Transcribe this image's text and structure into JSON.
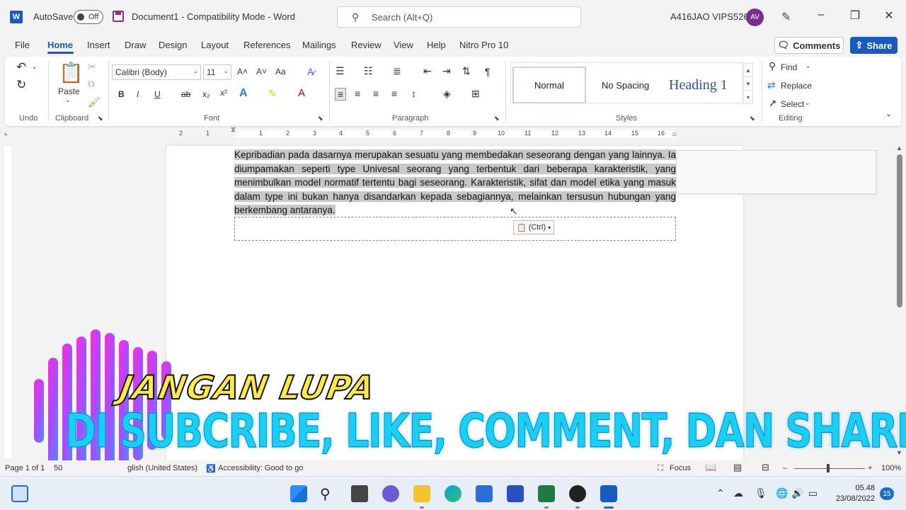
{
  "window": {
    "autosave_label": "AutoSave",
    "autosave_state": "Off",
    "title": "Document1  -  Compatibility Mode  -  Word",
    "search_placeholder": "Search (Alt+Q)",
    "user_name": "A416JAO VIPS526",
    "avatar_initials": "AV",
    "app_logo": "W"
  },
  "menu": {
    "items": [
      "File",
      "Home",
      "Insert",
      "Draw",
      "Design",
      "Layout",
      "References",
      "Mailings",
      "Review",
      "View",
      "Help",
      "Nitro Pro 10"
    ],
    "active": "Home",
    "comments_label": "Comments",
    "share_label": "Share"
  },
  "ribbon": {
    "undo_label": "Undo",
    "clipboard_label": "Clipboard",
    "paste_label": "Paste",
    "font_label": "Font",
    "font_name": "Calibri (Body)",
    "font_size": "11",
    "paragraph_label": "Paragraph",
    "styles_label": "Styles",
    "styles": [
      "Normal",
      "No Spacing",
      "Heading 1"
    ],
    "editing_label": "Editing",
    "find_label": "Find",
    "replace_label": "Replace",
    "select_label": "Select",
    "grow_font": "A˄",
    "shrink_font": "A˅",
    "change_case": "Aa",
    "bold": "B",
    "italic": "I",
    "underline": "U",
    "strike": "ab",
    "subscript": "x₂",
    "superscript": "x²",
    "text_effects": "A",
    "highlight": "✎",
    "font_color": "A",
    "pilcrow": "¶"
  },
  "ruler_numbers": [
    "2",
    "1",
    "1",
    "2",
    "3",
    "4",
    "5",
    "6",
    "7",
    "8",
    "9",
    "10",
    "11",
    "12",
    "13",
    "14",
    "15",
    "16"
  ],
  "document": {
    "paragraph": "Kepribadian pada dasarnya merupakan sesuatu yang membedakan seseorang dengan  yang lainnya. Ia diumpamakan seperti type Univesal seorang yang terbentuk dari beberapa karakteristik, yang menimbulkan model normatif tertentu bagi seseorang. Karakteristik, sifat dan model etika yang masuk dalam type ini bukan hanya disandarkan kepada sebagiannya, melainkan tersusun hubungan yang berkembang antaranya.",
    "paste_options": "(Ctrl)"
  },
  "overlay": {
    "line1": "JANGAN LUPA",
    "line2": "DI SUBCRIBE, LIKE, COMMENT, DAN SHARE"
  },
  "status": {
    "page": "Page 1 of 1",
    "words": "50",
    "language": "glish (United States)",
    "accessibility": "Accessibility: Good to go",
    "focus": "Focus",
    "zoom": "100%"
  },
  "taskbar": {
    "time": "05.48",
    "date": "23/08/2022",
    "notifications": "15"
  },
  "colors": {
    "accent": "#185abd",
    "avatar": "#7c2c8c",
    "overlay_yellow": "#ffe84a",
    "overlay_cyan": "#1ad0f0"
  }
}
